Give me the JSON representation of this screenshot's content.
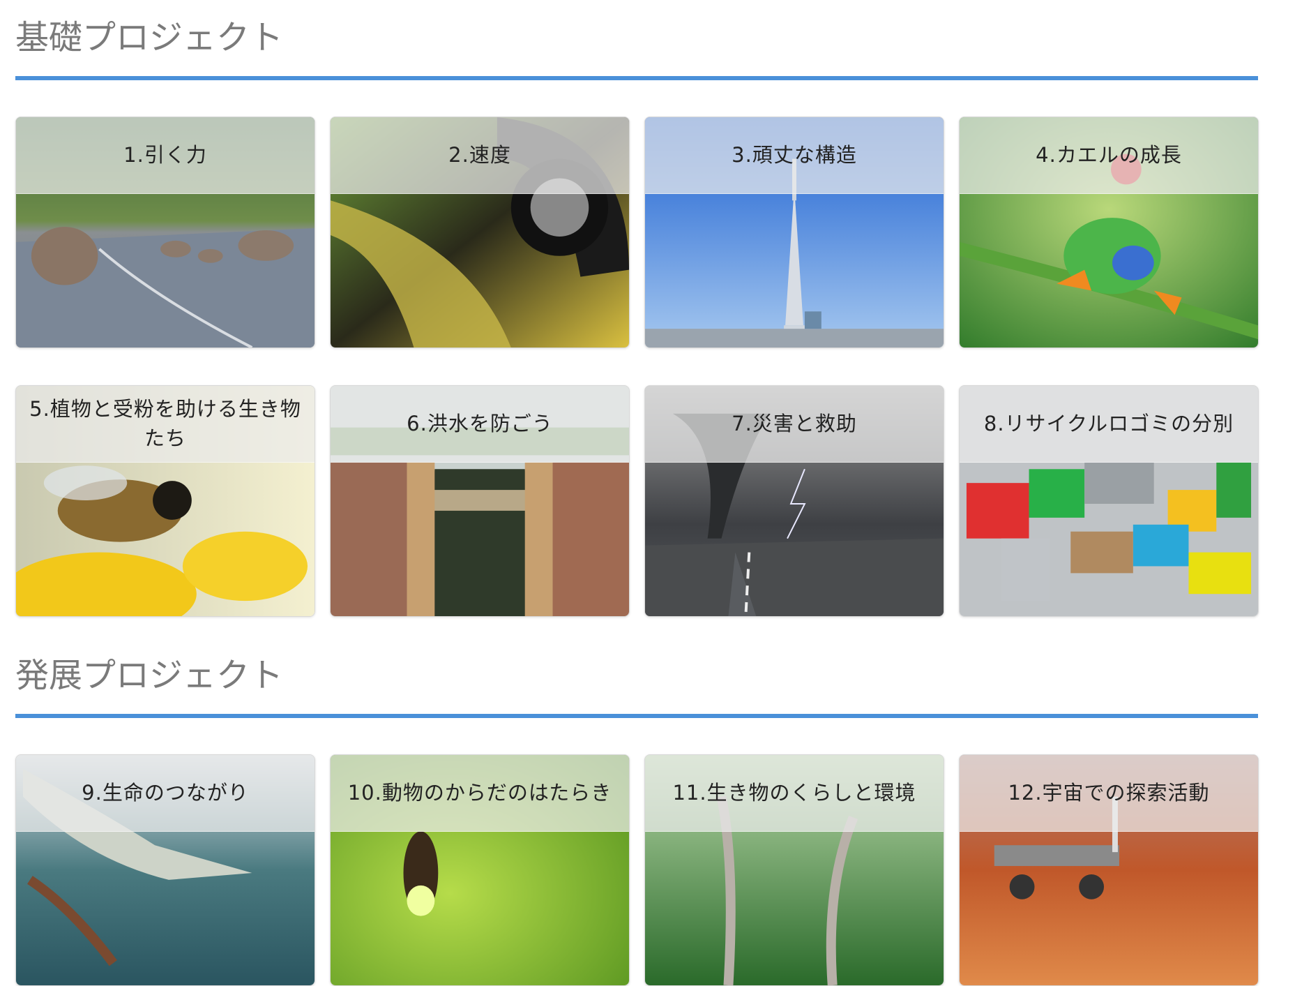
{
  "sections": [
    {
      "title": "基礎プロジェクト",
      "cards": [
        {
          "label": "1.引く力",
          "image": "boulders-on-road"
        },
        {
          "label": "2.速度",
          "image": "car-wheel-motion"
        },
        {
          "label": "3.頑丈な構造",
          "image": "skytree-tower"
        },
        {
          "label": "4.カエルの成長",
          "image": "tree-frog"
        },
        {
          "label": "5.植物と受粉を助ける生き物たち",
          "image": "bee-on-flowers"
        },
        {
          "label": "6.洪水を防ごう",
          "image": "canal-lock"
        },
        {
          "label": "7.災害と救助",
          "image": "tornado-road"
        },
        {
          "label": "8.リサイクルロゴミの分別",
          "image": "recycling-waste"
        }
      ]
    },
    {
      "title": "発展プロジェクト",
      "cards": [
        {
          "label": "9.生命のつながり",
          "image": "crocodile"
        },
        {
          "label": "10.動物のからだのはたらき",
          "image": "firefly"
        },
        {
          "label": "11.生き物のくらしと環境",
          "image": "dinosaurs-forest"
        },
        {
          "label": "12.宇宙での探索活動",
          "image": "mars-rover"
        }
      ]
    }
  ]
}
